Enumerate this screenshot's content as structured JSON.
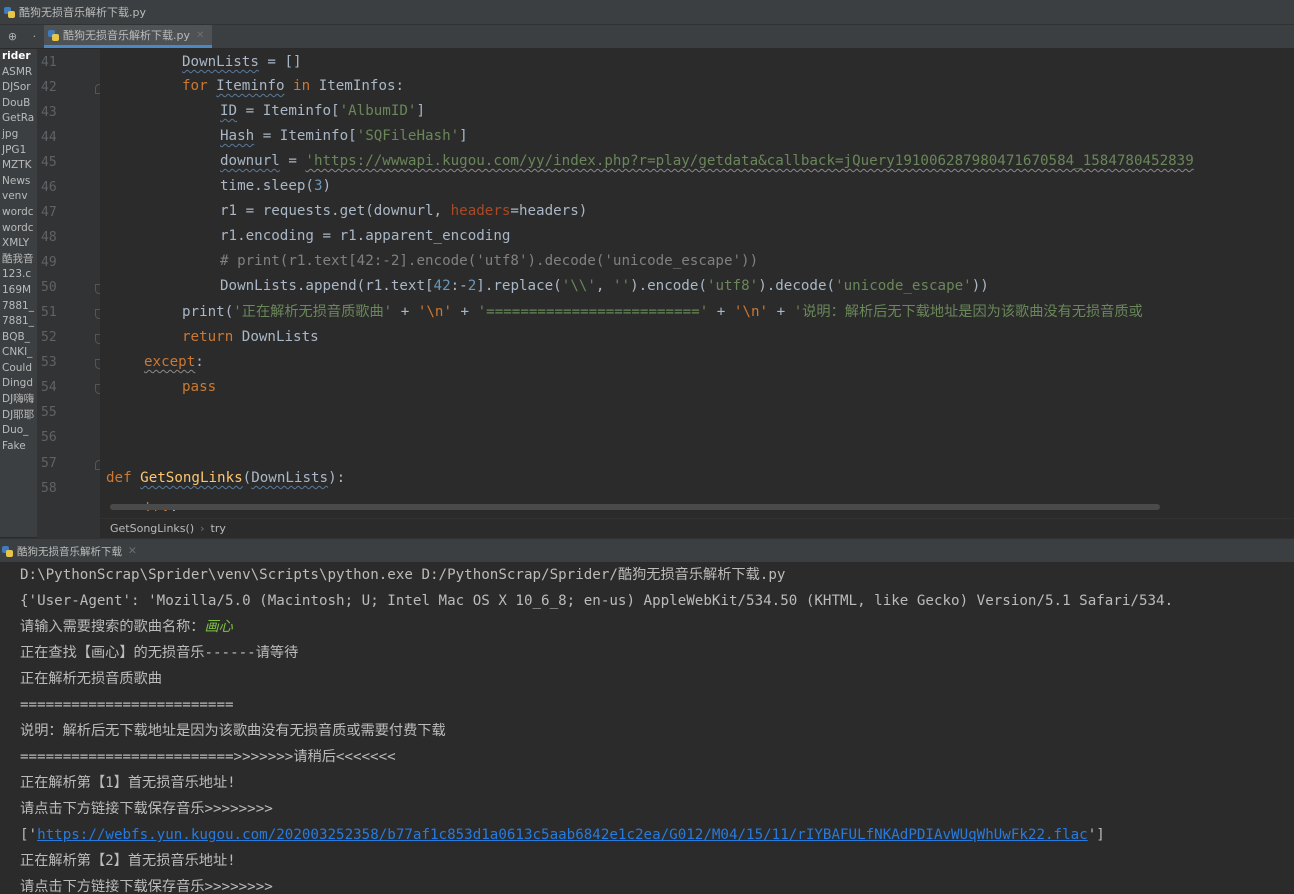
{
  "window": {
    "title": "酷狗无损音乐解析下载.py"
  },
  "tab": {
    "label": "酷狗无损音乐解析下载.py",
    "active": true
  },
  "project": {
    "root": "rider",
    "items": [
      "ASMR",
      "DJSor",
      "DouB",
      "GetRa",
      "jpg",
      "JPG1",
      "MZTK",
      "News",
      "venv",
      "wordc",
      "wordc",
      "XMLY",
      "酷我音",
      "123.c",
      "169M",
      "7881_",
      "7881_",
      "BQB_",
      "CNKI_",
      "Could",
      "Dingd",
      "DJ嗨嗨",
      "DJ耶耶",
      "Duo_",
      "Fake"
    ]
  },
  "editor": {
    "line_numbers": [
      "41",
      "42",
      "43",
      "44",
      "45",
      "46",
      "47",
      "48",
      "49",
      "50",
      "51",
      "52",
      "53",
      "54",
      "55",
      "56",
      "57",
      "58"
    ],
    "code": {
      "l41": {
        "var": "DownLists",
        "rest": " = []"
      },
      "l42": {
        "for": "for",
        "var": "Iteminfo",
        "in": " in ",
        "iter": "ItemInfos:"
      },
      "l43": {
        "var": "ID",
        "pre": " = Iteminfo[",
        "str": "'AlbumID'",
        "post": "]"
      },
      "l44": {
        "var": "Hash",
        "pre": " = Iteminfo[",
        "str": "'SQFileHash'",
        "post": "]"
      },
      "l45": {
        "var": "downurl",
        "pre": " = ",
        "str": "'https://wwwapi.kugou.com/yy/index.php?r=play/getdata&callback=jQuery191006287980471670584_1584780452839"
      },
      "l46": {
        "pre": "time.sleep(",
        "num": "3",
        "post": ")"
      },
      "l47": {
        "pre": "r1 = requests.get(downurl, ",
        "kw": "headers",
        "post": "=headers)"
      },
      "l48": {
        "text": "r1.encoding = r1.apparent_encoding"
      },
      "l49": {
        "comment": "# print(r1.text[42:-2].encode('utf8').decode('unicode_escape'))"
      },
      "l50": {
        "a": "DownLists.append(r1.text[",
        "n1": "42",
        "b": ":-",
        "n2": "2",
        "c": "].replace(",
        "s1": "'\\\\'",
        "d": ", ",
        "s2": "''",
        "e": ").encode(",
        "s3": "'utf8'",
        "f": ").decode(",
        "s4": "'unicode_escape'",
        "g": "))"
      },
      "l51": {
        "a": "print(",
        "s1": "'正在解析无损音质歌曲'",
        "b": " + ",
        "s2": "'\\n'",
        "c": " + ",
        "s3": "'========================='",
        "d": " + ",
        "s4": "'\\n'",
        "e": " + ",
        "s5": "'说明：解析后无下载地址是因为该歌曲没有无损音质或"
      },
      "l52": {
        "kw": "return",
        "rest": " DownLists"
      },
      "l53": {
        "kw": "except",
        "rest": ":"
      },
      "l54": {
        "kw": "pass"
      },
      "l57": {
        "kw": "def",
        "fn": "GetSongLinks",
        "a": "(",
        "param": "DownLists",
        "b": "):"
      },
      "l58": {
        "kw": "try",
        "rest": ":"
      }
    }
  },
  "breadcrumb": {
    "func": "GetSongLinks()",
    "sep": "›",
    "block": "try"
  },
  "run": {
    "tab_label": "酷狗无损音乐解析下载"
  },
  "console": {
    "cmd": "D:\\PythonScrap\\Sprider\\venv\\Scripts\\python.exe D:/PythonScrap/Sprider/酷狗无损音乐解析下载.py",
    "ua": "{'User-Agent': 'Mozilla/5.0 (Macintosh; U; Intel Mac OS X 10_6_8; en-us) AppleWebKit/534.50 (KHTML, like Gecko) Version/5.1 Safari/534.",
    "prompt": "请输入需要搜索的歌曲名称：",
    "input": "画心",
    "searching": "正在查找【画心】的无损音乐------请等待",
    "parsing": "正在解析无损音质歌曲",
    "divider": "=========================",
    "note": "说明：解析后无下载地址是因为该歌曲没有无损音质或需要付费下载",
    "wait": "=========================>>>>>>>请稍后<<<<<<<",
    "item1": "正在解析第【1】首无损音乐地址!",
    "click1": "请点击下方链接下载保存音乐>>>>>>>>",
    "link_open": "['",
    "link": "https://webfs.yun.kugou.com/202003252358/b77af1c853d1a0613c5aab6842e1c2ea/G012/M04/15/11/rIYBAFULfNKAdPDIAvWUqWhUwFk22.flac",
    "link_close": "']",
    "item2": "正在解析第【2】首无损音乐地址!",
    "click2": "请点击下方链接下载保存音乐>>>>>>>>"
  }
}
